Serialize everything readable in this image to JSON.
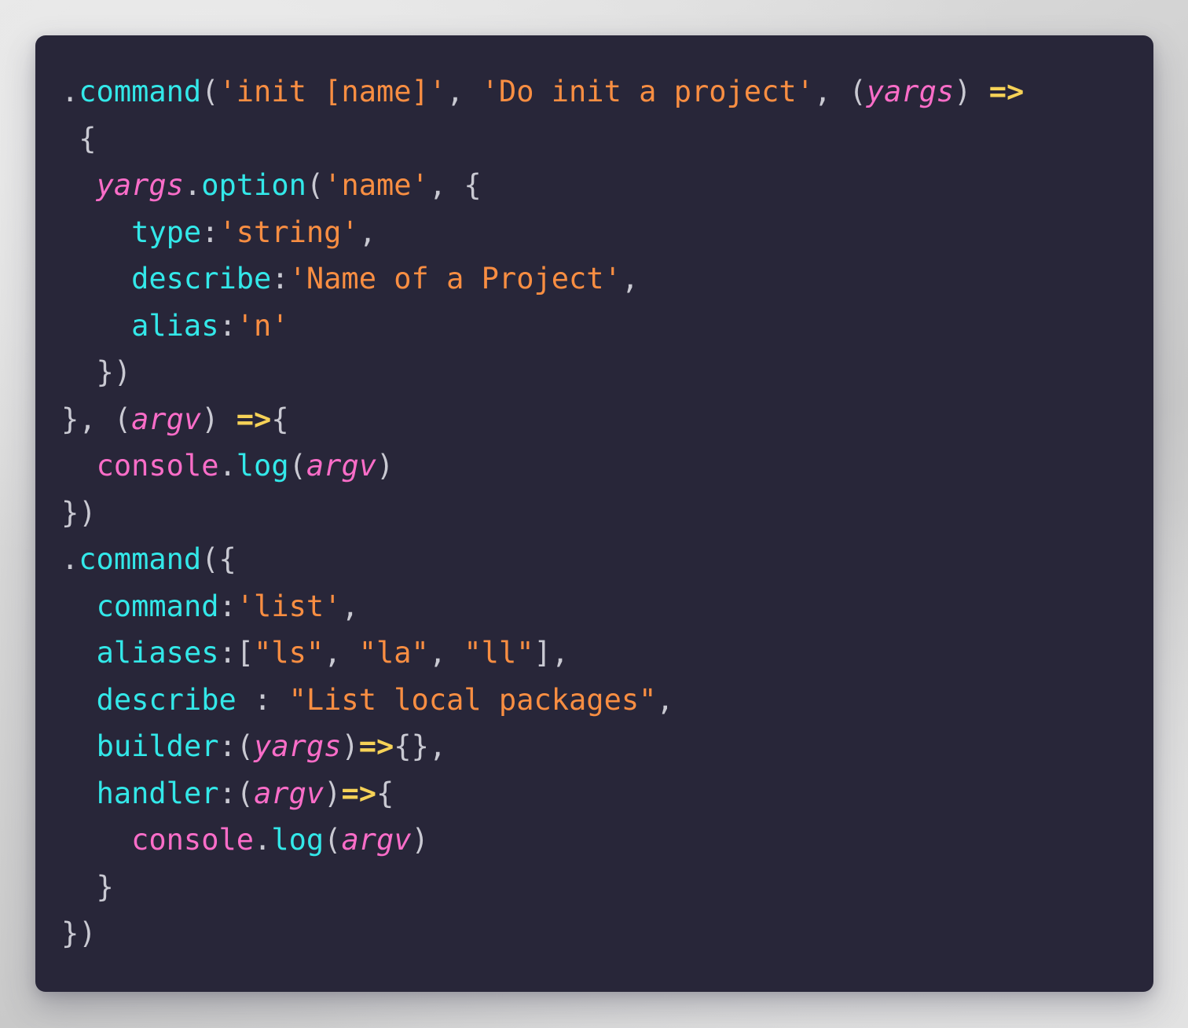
{
  "editor": {
    "language": "javascript",
    "background_color": "#282639",
    "page_background_color": "#d8d8d8",
    "font_size_px": 37,
    "line_count": 18,
    "palette": {
      "function": "#33e8e9",
      "property_key": "#33e8e9",
      "string": "#f98e42",
      "variable_italic": "#fa6dc8",
      "object": "#fa6dc8",
      "arrow": "#f6d257",
      "punctuation": "#c9c9d2"
    },
    "plain_text": ".command('init [name]', 'Do init a project', (yargs) =>\n {\n  yargs.option('name', {\n    type:'string',\n    describe:'Name of a Project',\n    alias:'n'\n  })\n}, (argv) =>{\n  console.log(argv)\n})\n.command({\n  command:'list',\n  aliases:[\"ls\", \"la\", \"ll\"],\n  describe : \"List local packages\",\n  builder:(yargs)=>{},\n  handler:(argv)=>{\n    console.log(argv)\n  }\n})",
    "lines": [
      {
        "n": 1,
        "tokens": [
          {
            "t": ".",
            "c": "punc"
          },
          {
            "t": "command",
            "c": "fn"
          },
          {
            "t": "(",
            "c": "punc"
          },
          {
            "t": "'init [name]'",
            "c": "str"
          },
          {
            "t": ", ",
            "c": "punc"
          },
          {
            "t": "'Do init a project'",
            "c": "str"
          },
          {
            "t": ", ",
            "c": "punc"
          },
          {
            "t": "(",
            "c": "punc"
          },
          {
            "t": "yargs",
            "c": "var"
          },
          {
            "t": ")",
            "c": "punc"
          },
          {
            "t": " ",
            "c": "plain"
          },
          {
            "t": "=>",
            "c": "arrow"
          }
        ]
      },
      {
        "n": 2,
        "tokens": [
          {
            "t": " {",
            "c": "punc"
          }
        ]
      },
      {
        "n": 3,
        "tokens": [
          {
            "t": "  ",
            "c": "plain"
          },
          {
            "t": "yargs",
            "c": "var"
          },
          {
            "t": ".",
            "c": "punc"
          },
          {
            "t": "option",
            "c": "fn"
          },
          {
            "t": "(",
            "c": "punc"
          },
          {
            "t": "'name'",
            "c": "str"
          },
          {
            "t": ", {",
            "c": "punc"
          }
        ]
      },
      {
        "n": 4,
        "tokens": [
          {
            "t": "    ",
            "c": "plain"
          },
          {
            "t": "type",
            "c": "key"
          },
          {
            "t": ":",
            "c": "punc"
          },
          {
            "t": "'string'",
            "c": "str"
          },
          {
            "t": ",",
            "c": "punc"
          }
        ]
      },
      {
        "n": 5,
        "tokens": [
          {
            "t": "    ",
            "c": "plain"
          },
          {
            "t": "describe",
            "c": "key"
          },
          {
            "t": ":",
            "c": "punc"
          },
          {
            "t": "'Name of a Project'",
            "c": "str"
          },
          {
            "t": ",",
            "c": "punc"
          }
        ]
      },
      {
        "n": 6,
        "tokens": [
          {
            "t": "    ",
            "c": "plain"
          },
          {
            "t": "alias",
            "c": "key"
          },
          {
            "t": ":",
            "c": "punc"
          },
          {
            "t": "'n'",
            "c": "str"
          }
        ]
      },
      {
        "n": 7,
        "tokens": [
          {
            "t": "  })",
            "c": "punc"
          }
        ]
      },
      {
        "n": 8,
        "tokens": [
          {
            "t": "}, (",
            "c": "punc"
          },
          {
            "t": "argv",
            "c": "var"
          },
          {
            "t": ") ",
            "c": "punc"
          },
          {
            "t": "=>",
            "c": "arrow"
          },
          {
            "t": "{",
            "c": "punc"
          }
        ]
      },
      {
        "n": 9,
        "tokens": [
          {
            "t": "  ",
            "c": "plain"
          },
          {
            "t": "console",
            "c": "obj"
          },
          {
            "t": ".",
            "c": "punc"
          },
          {
            "t": "log",
            "c": "fn"
          },
          {
            "t": "(",
            "c": "punc"
          },
          {
            "t": "argv",
            "c": "var"
          },
          {
            "t": ")",
            "c": "punc"
          }
        ]
      },
      {
        "n": 10,
        "tokens": [
          {
            "t": "})",
            "c": "punc"
          }
        ]
      },
      {
        "n": 11,
        "tokens": [
          {
            "t": ".",
            "c": "punc"
          },
          {
            "t": "command",
            "c": "fn"
          },
          {
            "t": "({",
            "c": "punc"
          }
        ]
      },
      {
        "n": 12,
        "tokens": [
          {
            "t": "  ",
            "c": "plain"
          },
          {
            "t": "command",
            "c": "key"
          },
          {
            "t": ":",
            "c": "punc"
          },
          {
            "t": "'list'",
            "c": "str"
          },
          {
            "t": ",",
            "c": "punc"
          }
        ]
      },
      {
        "n": 13,
        "tokens": [
          {
            "t": "  ",
            "c": "plain"
          },
          {
            "t": "aliases",
            "c": "key"
          },
          {
            "t": ":[",
            "c": "punc"
          },
          {
            "t": "\"ls\"",
            "c": "str"
          },
          {
            "t": ", ",
            "c": "punc"
          },
          {
            "t": "\"la\"",
            "c": "str"
          },
          {
            "t": ", ",
            "c": "punc"
          },
          {
            "t": "\"ll\"",
            "c": "str"
          },
          {
            "t": "],",
            "c": "punc"
          }
        ]
      },
      {
        "n": 14,
        "tokens": [
          {
            "t": "  ",
            "c": "plain"
          },
          {
            "t": "describe",
            "c": "key"
          },
          {
            "t": " : ",
            "c": "punc"
          },
          {
            "t": "\"List local packages\"",
            "c": "str"
          },
          {
            "t": ",",
            "c": "punc"
          }
        ]
      },
      {
        "n": 15,
        "tokens": [
          {
            "t": "  ",
            "c": "plain"
          },
          {
            "t": "builder",
            "c": "key"
          },
          {
            "t": ":(",
            "c": "punc"
          },
          {
            "t": "yargs",
            "c": "var"
          },
          {
            "t": ")",
            "c": "punc"
          },
          {
            "t": "=>",
            "c": "arrow"
          },
          {
            "t": "{},",
            "c": "punc"
          }
        ]
      },
      {
        "n": 16,
        "tokens": [
          {
            "t": "  ",
            "c": "plain"
          },
          {
            "t": "handler",
            "c": "key"
          },
          {
            "t": ":(",
            "c": "punc"
          },
          {
            "t": "argv",
            "c": "var"
          },
          {
            "t": ")",
            "c": "punc"
          },
          {
            "t": "=>",
            "c": "arrow"
          },
          {
            "t": "{",
            "c": "punc"
          }
        ]
      },
      {
        "n": 17,
        "tokens": [
          {
            "t": "    ",
            "c": "plain"
          },
          {
            "t": "console",
            "c": "obj"
          },
          {
            "t": ".",
            "c": "punc"
          },
          {
            "t": "log",
            "c": "fn"
          },
          {
            "t": "(",
            "c": "punc"
          },
          {
            "t": "argv",
            "c": "var"
          },
          {
            "t": ")",
            "c": "punc"
          }
        ]
      },
      {
        "n": 18,
        "tokens": [
          {
            "t": "  }",
            "c": "punc"
          }
        ]
      },
      {
        "n": 19,
        "tokens": [
          {
            "t": "})",
            "c": "punc"
          }
        ]
      }
    ]
  }
}
